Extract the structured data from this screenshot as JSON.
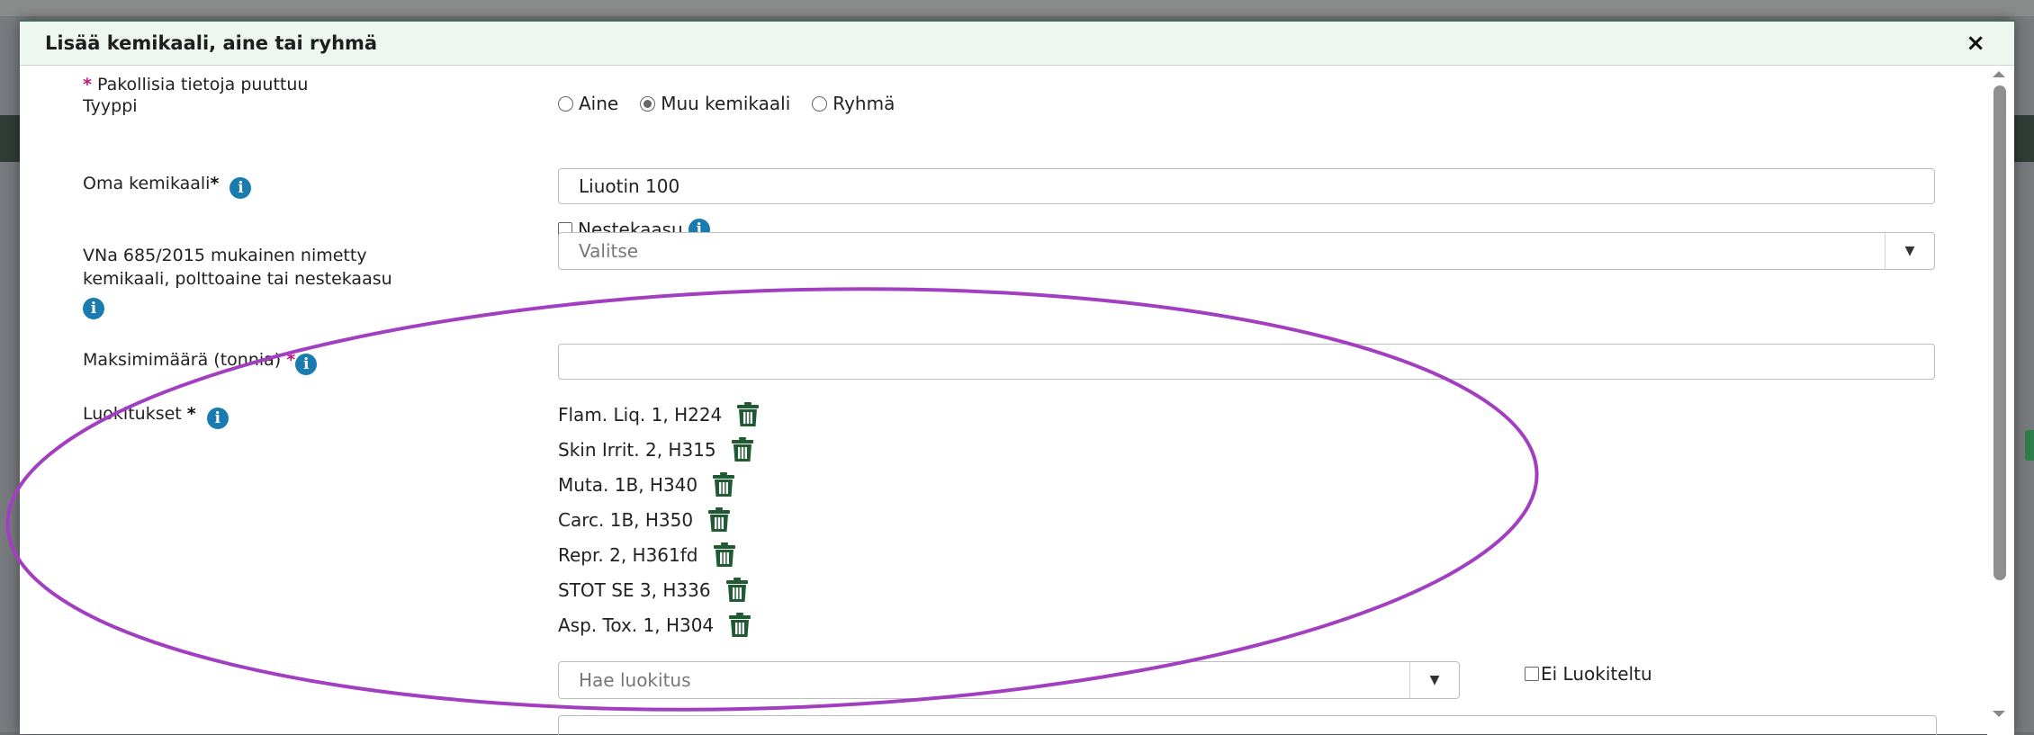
{
  "modal": {
    "title": "Lisää kemikaali, aine tai ryhmä",
    "close_label": "×"
  },
  "form": {
    "missing_notice": "Pakollisia tietoja puuttuu",
    "required_mark": "*",
    "type": {
      "label": "Tyyppi",
      "options": [
        {
          "label": "Aine",
          "selected": false
        },
        {
          "label": "Muu kemikaali",
          "selected": true
        },
        {
          "label": "Ryhmä",
          "selected": false
        }
      ]
    },
    "own_chemical": {
      "label": "Oma kemikaali",
      "value": "Liuotin 100"
    },
    "liquefied_gas": {
      "label": "Nestekaasu",
      "checked": false
    },
    "vna_named": {
      "label_line1": "VNa 685/2015 mukainen nimetty",
      "label_line2": "kemikaali, polttoaine tai nestekaasu",
      "placeholder": "Valitse"
    },
    "max_amount": {
      "label": "Maksimimäärä (tonnia)",
      "value": ""
    },
    "classifications": {
      "label": "Luokitukset",
      "items": [
        "Flam. Liq. 1, H224",
        "Skin Irrit. 2, H315",
        "Muta. 1B, H340",
        "Carc. 1B, H350",
        "Repr. 2, H361fd",
        "STOT SE 3, H336",
        "Asp. Tox. 1, H304"
      ],
      "search_placeholder": "Hae luokitus",
      "unclassified_label": "Ei Luokiteltu"
    }
  },
  "icons": {
    "info": "info-icon",
    "delete": "trash-icon",
    "dropdown": "chevron-down-icon"
  },
  "colors": {
    "header_bg": "#edf7ef",
    "required": "#c0157a",
    "info": "#1a7bb0",
    "trash": "#1f5a32",
    "annotation": "#a23fc0"
  }
}
